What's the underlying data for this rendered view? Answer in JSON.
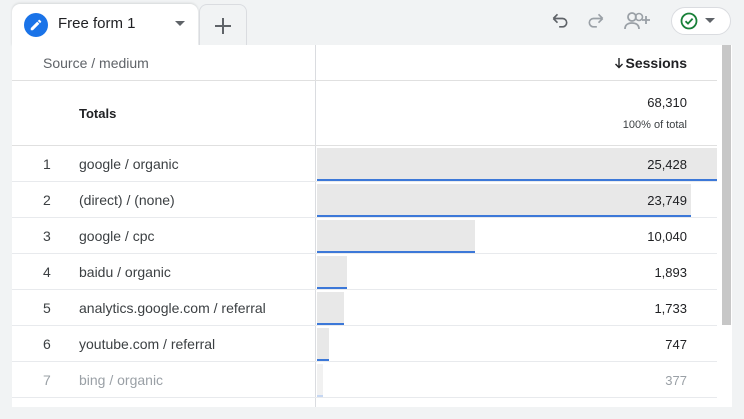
{
  "tab": {
    "name": "Free form 1",
    "icon": "pencil-icon",
    "accent": "#1a73e8"
  },
  "toolbar": {
    "undo_icon": "undo-icon",
    "redo_icon": "redo-icon",
    "share_icon": "share-users-icon",
    "status_icon": "check-circle-icon"
  },
  "table": {
    "dimension_header": "Source / medium",
    "metric_header": "Sessions",
    "sort_icon": "arrow-down-icon",
    "totals": {
      "label": "Totals",
      "value": "68,310",
      "percent": "100% of total"
    },
    "rows": [
      {
        "index": "1",
        "dimension": "google / organic",
        "value": "25,428",
        "share": 1.0
      },
      {
        "index": "2",
        "dimension": "(direct) / (none)",
        "value": "23,749",
        "share": 0.934
      },
      {
        "index": "3",
        "dimension": "google / cpc",
        "value": "10,040",
        "share": 0.395
      },
      {
        "index": "4",
        "dimension": "baidu / organic",
        "value": "1,893",
        "share": 0.074
      },
      {
        "index": "5",
        "dimension": "analytics.google.com / referral",
        "value": "1,733",
        "share": 0.068
      },
      {
        "index": "6",
        "dimension": "youtube.com / referral",
        "value": "747",
        "share": 0.029
      },
      {
        "index": "7",
        "dimension": "bing / organic",
        "value": "377",
        "share": 0.015
      }
    ]
  },
  "colors": {
    "bar": "#e8e8e8",
    "bar_line": "#3c78d8",
    "status_ok": "#188038"
  }
}
